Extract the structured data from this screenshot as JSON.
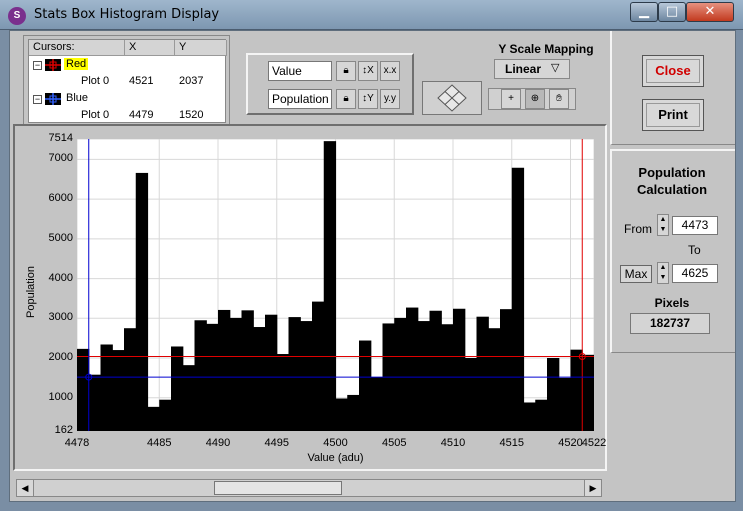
{
  "window": {
    "title": "Stats Box Histogram Display",
    "icon": "stats-app-icon"
  },
  "cursor_legend": {
    "headers": [
      "Cursors:",
      "X",
      "Y"
    ],
    "cursors": [
      {
        "name": "Red",
        "plot": "Plot 0",
        "x": "4521",
        "y": "2037",
        "color": "#e00000",
        "highlight": "#ffff00"
      },
      {
        "name": "Blue",
        "plot": "Plot 0",
        "x": "4479",
        "y": "1520",
        "color": "#0000e0"
      }
    ]
  },
  "axis_fields": {
    "x_name": "Value",
    "y_name": "Population"
  },
  "y_scale": {
    "label": "Y Scale Mapping",
    "value": "Linear"
  },
  "buttons": {
    "close": "Close",
    "print": "Print"
  },
  "population_calc": {
    "title_line1": "Population",
    "title_line2": "Calculation",
    "from_label": "From",
    "from_value": "4473",
    "to_label": "To",
    "max_label": "Max",
    "to_value": "4625",
    "pixels_label": "Pixels",
    "pixels_value": "182737"
  },
  "chart_data": {
    "type": "bar",
    "xlabel": "Value (adu)",
    "ylabel": "Population",
    "ylim": [
      162,
      7514
    ],
    "xlim": [
      4478,
      4522
    ],
    "yticks": [
      "7514",
      "7000",
      "6000",
      "5000",
      "4000",
      "3000",
      "2000",
      "1000",
      "162"
    ],
    "xticks": [
      "4478",
      "4485",
      "4490",
      "4495",
      "4500",
      "4505",
      "4510",
      "4515",
      "4520",
      "4522"
    ],
    "x": [
      4478,
      4479,
      4480,
      4481,
      4482,
      4483,
      4484,
      4485,
      4486,
      4487,
      4488,
      4489,
      4490,
      4491,
      4492,
      4493,
      4494,
      4495,
      4496,
      4497,
      4498,
      4499,
      4500,
      4501,
      4502,
      4503,
      4504,
      4505,
      4506,
      4507,
      4508,
      4509,
      4510,
      4511,
      4512,
      4513,
      4514,
      4515,
      4516,
      4517,
      4518,
      4519,
      4520,
      4521
    ],
    "values": [
      2230,
      1580,
      2340,
      2200,
      2750,
      6660,
      770,
      950,
      2290,
      1820,
      2950,
      2860,
      3210,
      3010,
      3200,
      2780,
      3090,
      2100,
      3030,
      2930,
      3420,
      7460,
      980,
      1070,
      2440,
      1520,
      2870,
      3010,
      3270,
      2930,
      3190,
      2850,
      3240,
      2000,
      3040,
      2750,
      3230,
      6790,
      880,
      950,
      2000,
      1500,
      2210,
      2080
    ],
    "cursors": [
      {
        "name": "Red",
        "x": 4521,
        "y": 2037
      },
      {
        "name": "Blue",
        "x": 4479,
        "y": 1520
      }
    ]
  }
}
